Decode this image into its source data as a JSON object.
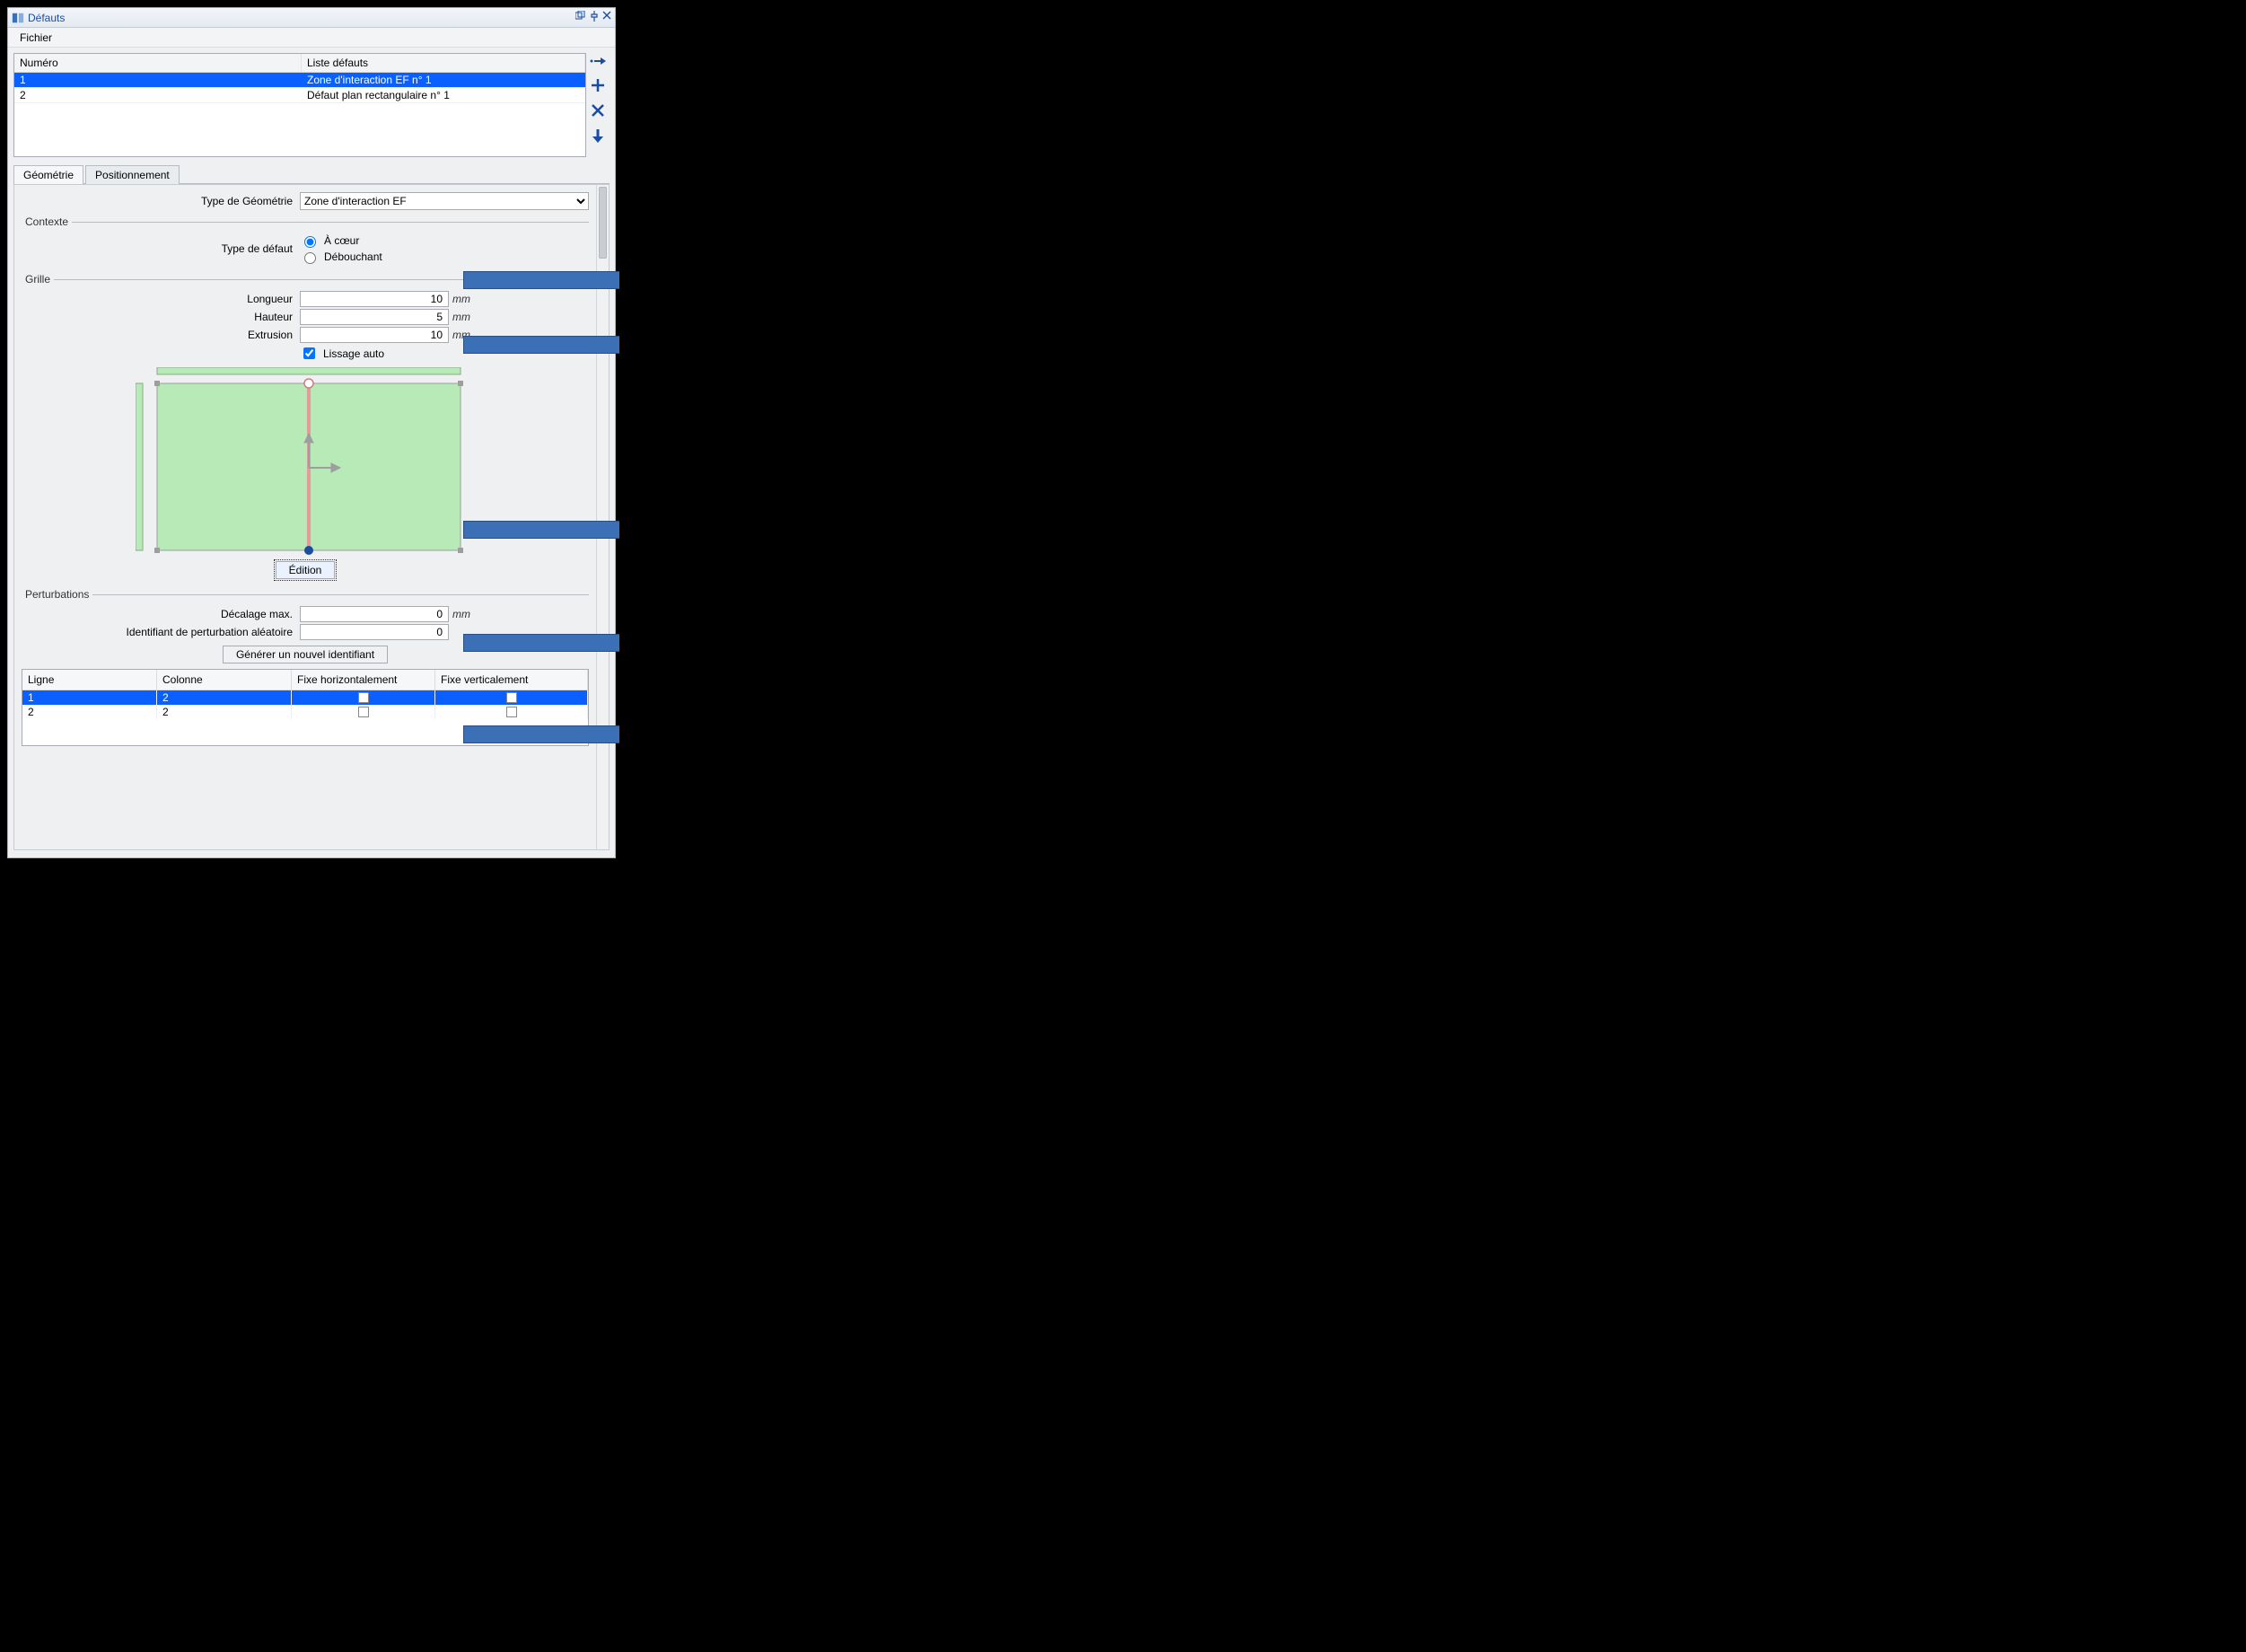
{
  "window": {
    "title": "Défauts",
    "btn_dock": "⧉",
    "btn_pin": "🔲",
    "btn_close": "✕"
  },
  "menu": {
    "file": "Fichier"
  },
  "list": {
    "col_num": "Numéro",
    "col_list": "Liste défauts",
    "rows": [
      {
        "num": "1",
        "desc": "Zone d'interaction EF n° 1"
      },
      {
        "num": "2",
        "desc": "Défaut plan rectangulaire n° 1"
      }
    ]
  },
  "side": {
    "assign_tip": "Affecter",
    "add_tip": "Ajouter",
    "del_tip": "Supprimer",
    "down_tip": "Descendre"
  },
  "tabs": {
    "geometry": "Géométrie",
    "positioning": "Positionnement"
  },
  "geometry": {
    "type_label": "Type de Géométrie",
    "type_value": "Zone d'interaction EF",
    "contexte_legend": "Contexte",
    "defect_type_label": "Type de défaut",
    "defect_type_core": "À cœur",
    "defect_type_surface": "Débouchant",
    "grille_legend": "Grille",
    "longueur_label": "Longueur",
    "longueur_value": "10",
    "hauteur_label": "Hauteur",
    "hauteur_value": "5",
    "extrusion_label": "Extrusion",
    "extrusion_value": "10",
    "unit_mm": "mm",
    "lissage_label": "Lissage auto",
    "edition_btn": "Édition",
    "perturb_legend": "Perturbations",
    "decalage_label": "Décalage max.",
    "decalage_value": "0",
    "ident_label": "Identifiant de perturbation aléatoire",
    "ident_value": "0",
    "gen_btn": "Générer un nouvel identifiant",
    "pcols": {
      "ligne": "Ligne",
      "colonne": "Colonne",
      "fixh": "Fixe horizontalement",
      "fixv": "Fixe verticalement"
    },
    "prows": [
      {
        "ligne": "1",
        "colonne": "2",
        "fixh": false,
        "fixv": false
      },
      {
        "ligne": "2",
        "colonne": "2",
        "fixh": false,
        "fixv": false
      }
    ]
  }
}
